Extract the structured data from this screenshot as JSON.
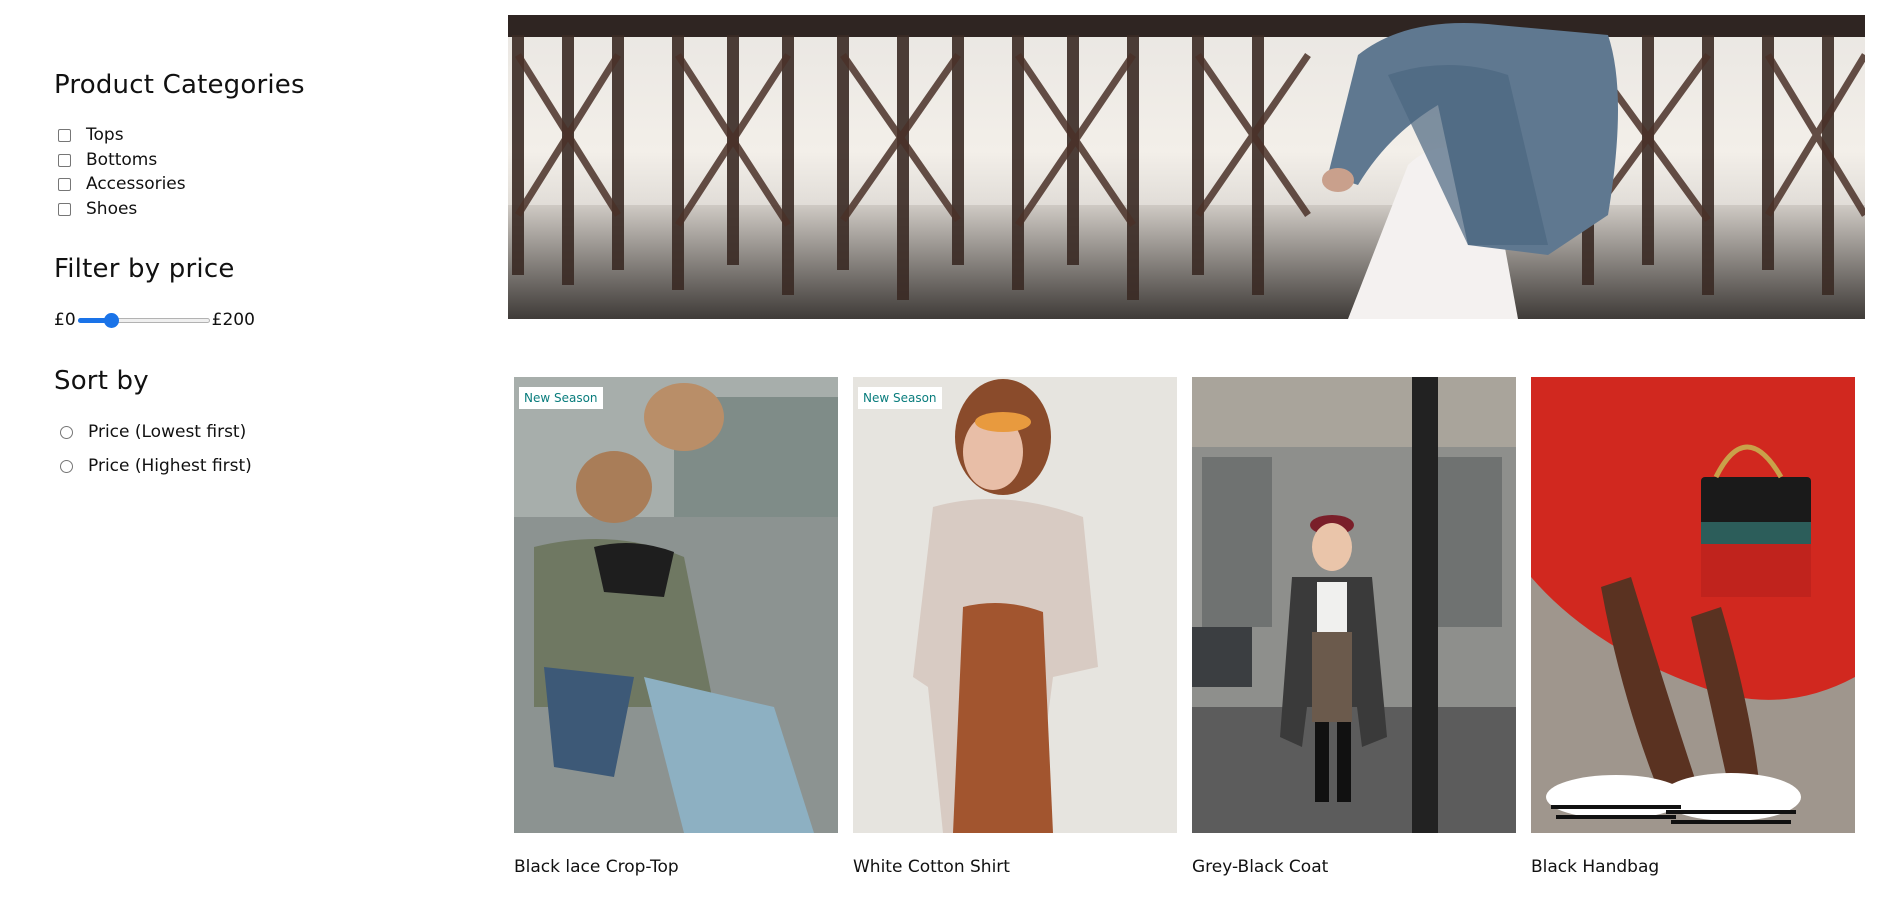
{
  "sidebar": {
    "categories_heading": "Product Categories",
    "categories": [
      "Tops",
      "Bottoms",
      "Accessories",
      "Shoes"
    ],
    "price_heading": "Filter by price",
    "price_min_label": "£0",
    "price_max_label": "£200",
    "price_slider_value_fraction": 0.25,
    "sort_heading": "Sort by",
    "sort_options": [
      "Price (Lowest first)",
      "Price (Highest first)"
    ]
  },
  "products": [
    {
      "title": "Black lace Crop-Top",
      "badge": "New Season"
    },
    {
      "title": "White Cotton Shirt",
      "badge": "New Season"
    },
    {
      "title": "Grey-Black Coat",
      "badge": ""
    },
    {
      "title": "Black Handbag",
      "badge": ""
    }
  ],
  "colors": {
    "accent": "#1a73e8",
    "badge_text": "#0a7d7d"
  }
}
